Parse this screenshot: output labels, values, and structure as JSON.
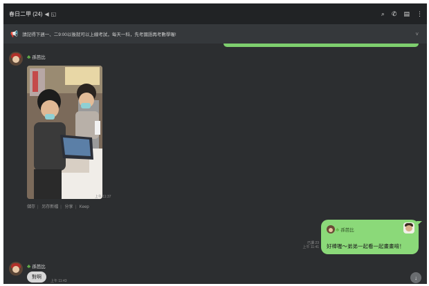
{
  "header": {
    "title": "春日二甲 (24)",
    "mute_icon": "speaker-muted-icon",
    "note_icon": "note-icon",
    "actions": [
      {
        "name": "search-icon",
        "glyph": "🔍"
      },
      {
        "name": "phone-icon",
        "glyph": "✆"
      },
      {
        "name": "panel-icon",
        "glyph": "▤"
      },
      {
        "name": "more-icon",
        "glyph": "⋮"
      }
    ]
  },
  "announcement": {
    "icon": "megaphone-icon",
    "text": "請記得下週一、二9:00以後就可以上線考試，每天一科，先考國語再考數學喔!",
    "chevron": "˅"
  },
  "messages": {
    "photo_message": {
      "sender": "孫芭比",
      "time": "上午 11:37",
      "actions": [
        "儲存",
        "另存新檔",
        "分享",
        "Keep"
      ]
    },
    "my_message": {
      "read": "已讀 23",
      "time": "上午 11:41",
      "reply_to": "孫芭比",
      "text": "好棒喔～弟弟一起看一起畫畫唷！"
    },
    "last_message": {
      "sender": "孫芭比",
      "text": "對啊",
      "time": "上午 11:43"
    }
  },
  "colors": {
    "background": "#2c2e30",
    "header": "#212325",
    "my_bubble": "#8bd979",
    "accent_clover": "#67b84c"
  },
  "scroll_button": "↓"
}
